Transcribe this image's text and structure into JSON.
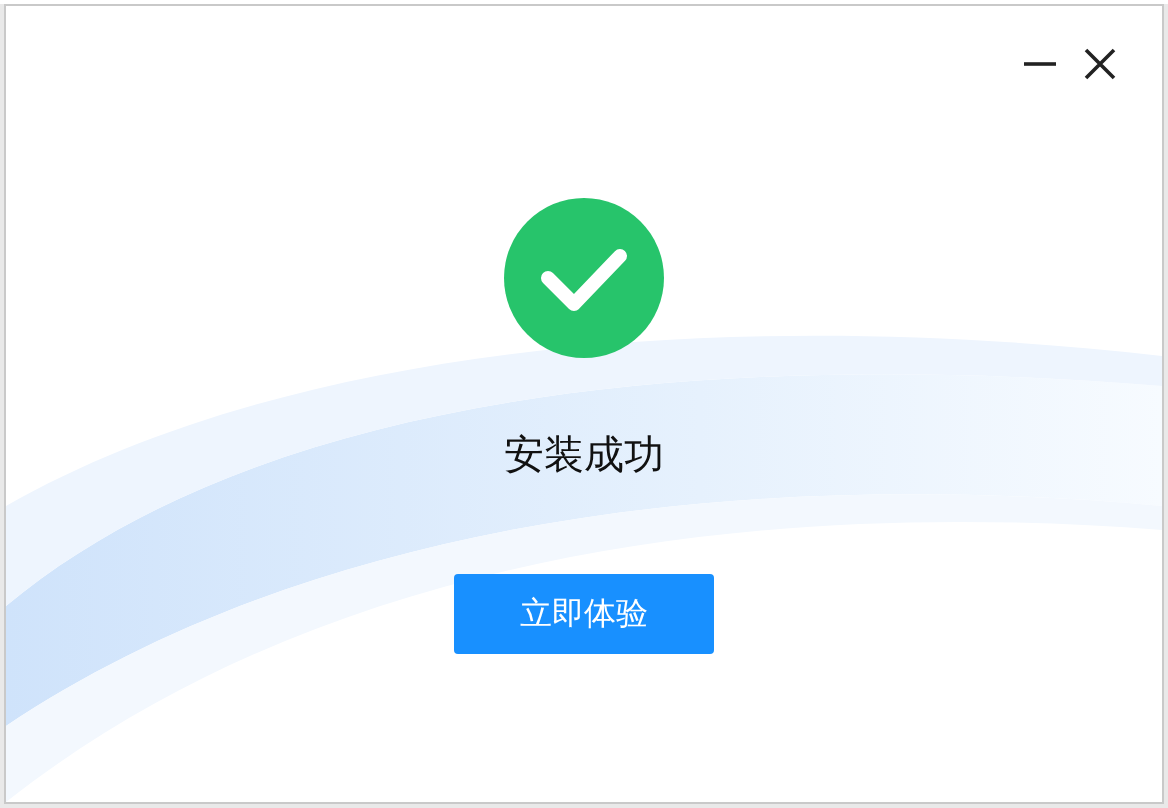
{
  "window_controls": [
    {
      "kind": "minimize"
    },
    {
      "kind": "close"
    }
  ],
  "status": {
    "kind": "success",
    "text": "安装成功"
  },
  "button": {
    "label": "立即体验"
  }
}
